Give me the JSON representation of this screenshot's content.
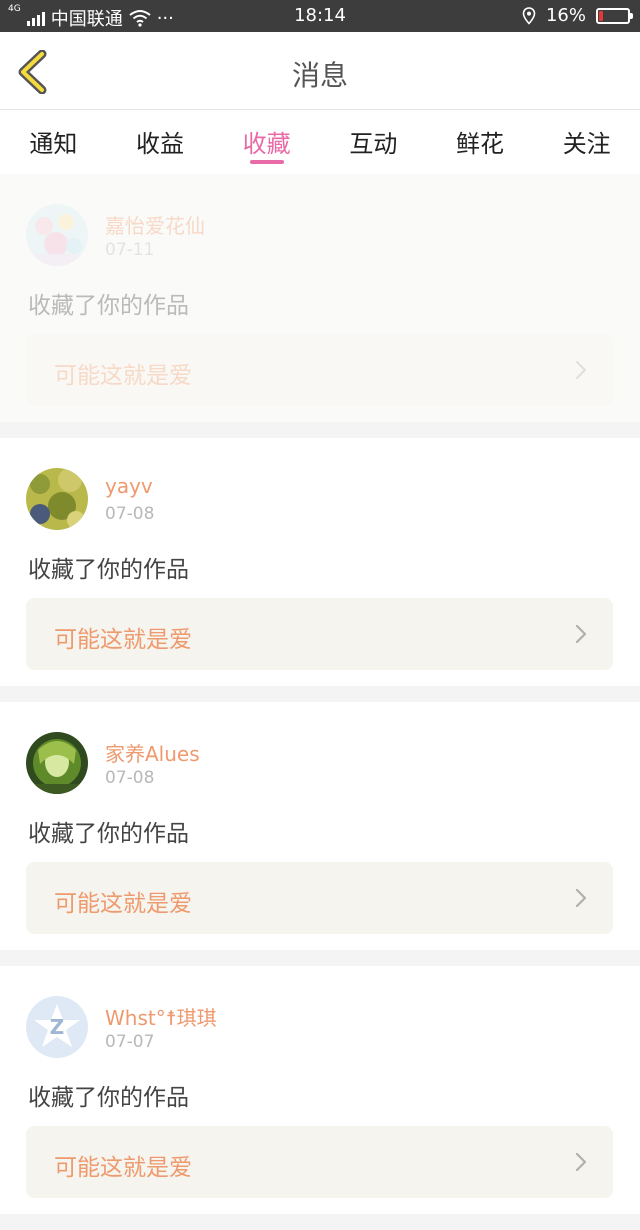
{
  "status_bar": {
    "network": "4G",
    "carrier": "中国联通",
    "more": "···",
    "time": "18:14",
    "battery_percent": "16%",
    "battery_level": 0.16,
    "battery_color": "#e53935"
  },
  "header": {
    "back_icon": "chevron-left-icon",
    "title": "消息"
  },
  "tabs": [
    {
      "label": "通知",
      "active": false
    },
    {
      "label": "收益",
      "active": false
    },
    {
      "label": "收藏",
      "active": true
    },
    {
      "label": "互动",
      "active": false
    },
    {
      "label": "鲜花",
      "active": false
    },
    {
      "label": "关注",
      "active": false
    }
  ],
  "accent_color": "#e86aa6",
  "name_color": "#ef9a6e",
  "feed": [
    {
      "user": "嘉怡爱花仙",
      "date": "07-11",
      "action": "收藏了你的作品",
      "work": "可能这就是爱",
      "faded": true
    },
    {
      "user": "yayv",
      "date": "07-08",
      "action": "收藏了你的作品",
      "work": "可能这就是爱",
      "faded": false
    },
    {
      "user": "家养Alues",
      "date": "07-08",
      "action": "收藏了你的作品",
      "work": "可能这就是爱",
      "faded": false
    },
    {
      "user": "Whst°☨琪琪",
      "date": "07-07",
      "action": "收藏了你的作品",
      "work": "可能这就是爱",
      "faded": false
    }
  ]
}
